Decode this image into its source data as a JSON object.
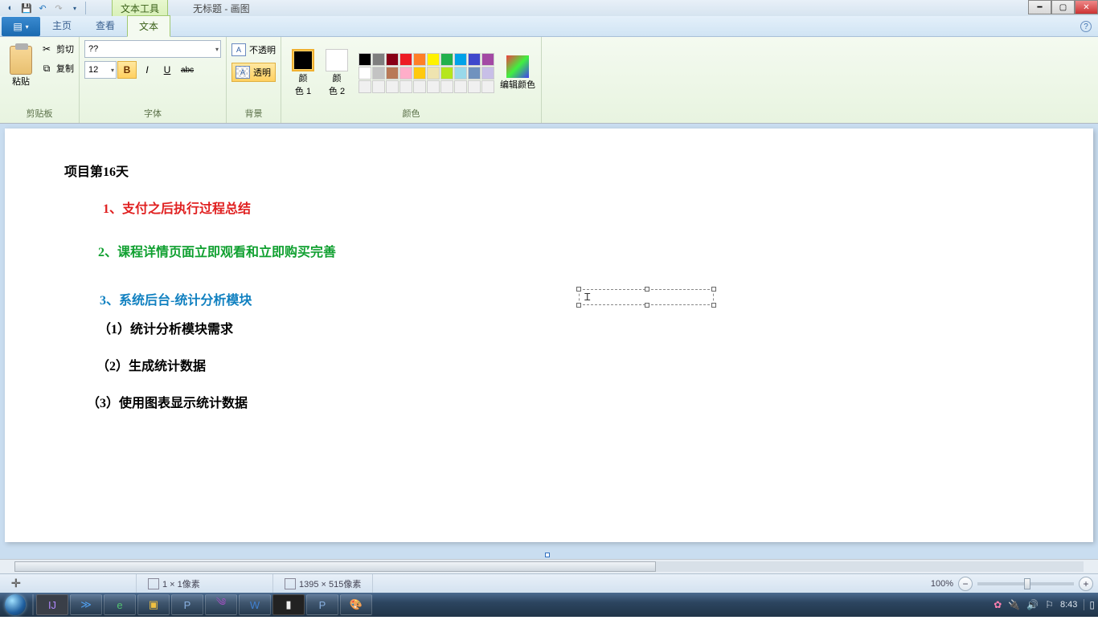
{
  "title_context_tab": "文本工具",
  "window_title": "无标题 - 画图",
  "tabs": {
    "home": "主页",
    "view": "查看",
    "text": "文本"
  },
  "ribbon": {
    "clipboard": {
      "paste": "粘贴",
      "cut": "剪切",
      "copy": "复制",
      "label": "剪贴板"
    },
    "font": {
      "name_value": "??",
      "size_value": "12",
      "b": "B",
      "i": "I",
      "u": "U",
      "abc": "abc",
      "label": "字体"
    },
    "bg": {
      "opaque": "不透明",
      "transparent": "透明",
      "label": "背景"
    },
    "colors": {
      "color1_a": "颜",
      "color1_b": "色 1",
      "color2_a": "颜",
      "color2_b": "色 2",
      "edit": "编辑颜色",
      "label": "颜色"
    }
  },
  "palette": {
    "r1": [
      "#000000",
      "#7f7f7f",
      "#880015",
      "#ed1c24",
      "#ff7f27",
      "#fff200",
      "#22b14c",
      "#00a2e8",
      "#3f48cc",
      "#a349a4"
    ],
    "r2": [
      "#ffffff",
      "#c3c3c3",
      "#b97a57",
      "#ffaec9",
      "#ffc90e",
      "#efe4b0",
      "#b5e61d",
      "#99d9ea",
      "#7092be",
      "#c8bfe7"
    ],
    "r3": [
      "#f0f0f0",
      "#f0f0f0",
      "#f0f0f0",
      "#f0f0f0",
      "#f0f0f0",
      "#f0f0f0",
      "#f0f0f0",
      "#f0f0f0",
      "#f0f0f0",
      "#f0f0f0"
    ]
  },
  "canvas_text": {
    "heading": "项目第16天",
    "l1": "1、支付之后执行过程总结",
    "l2": "2、课程详情页面立即观看和立即购买完善",
    "l3": "3、系统后台-统计分析模块",
    "l4": "（1）统计分析模块需求",
    "l5": "（2）生成统计数据",
    "l6": "（3）使用图表显示统计数据"
  },
  "status": {
    "selection": "1 × 1像素",
    "canvas_size": "1395 × 515像素",
    "zoom": "100%"
  },
  "taskbar_clock": "8:43"
}
